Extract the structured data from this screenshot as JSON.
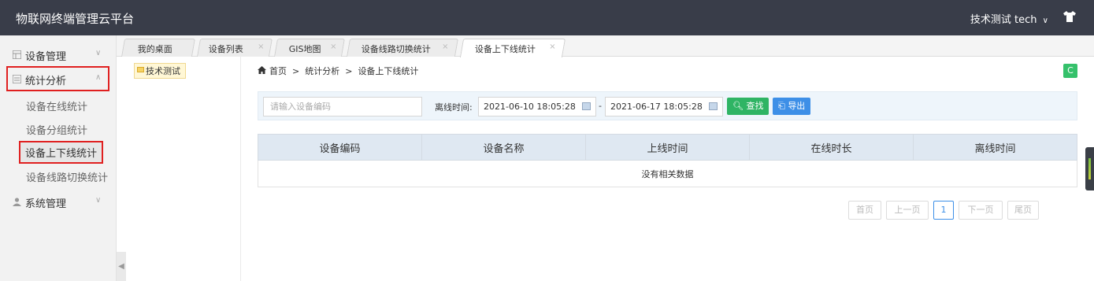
{
  "app": {
    "title": "物联网终端管理云平台",
    "user": "技术测试 tech",
    "user_caret": "∨"
  },
  "sidebar": {
    "groups": [
      {
        "label": "设备管理",
        "icon": "grid-icon",
        "arrow": "∨"
      },
      {
        "label": "统计分析",
        "icon": "chart-icon",
        "arrow": "∧"
      },
      {
        "label": "系统管理",
        "icon": "user-icon",
        "arrow": "∨"
      }
    ],
    "sub_items": [
      "设备在线统计",
      "设备分组统计",
      "设备上下线统计",
      "设备线路切换统计"
    ],
    "collapse_glyph": "◀"
  },
  "tabs": [
    {
      "label": "我的桌面",
      "closable": false
    },
    {
      "label": "设备列表",
      "closable": true
    },
    {
      "label": "GIS地图",
      "closable": true
    },
    {
      "label": "设备线路切换统计",
      "closable": true
    },
    {
      "label": "设备上下线统计",
      "closable": true
    }
  ],
  "tab_close_glyph": "×",
  "tree": {
    "node": "技术测试"
  },
  "breadcrumb": {
    "home": "首页",
    "sep": ">",
    "level1": "统计分析",
    "level2": "设备上下线统计"
  },
  "toolbar": {
    "refresh_glyph": "C"
  },
  "search": {
    "placeholder": "请输入设备编码",
    "offline_label": "离线时间:",
    "date_from": "2021-06-10 18:05:28",
    "date_dash": "-",
    "date_to": "2021-06-17 18:05:28",
    "search_button": "查找",
    "export_button": "导出"
  },
  "table": {
    "columns": [
      "设备编码",
      "设备名称",
      "上线时间",
      "在线时长",
      "离线时间"
    ],
    "empty_text": "没有相关数据"
  },
  "pager": {
    "first": "首页",
    "prev": "上一页",
    "current": "1",
    "next": "下一页",
    "last": "尾页"
  },
  "colors": {
    "topbar": "#393d49",
    "accent_green": "#2fb464",
    "accent_blue": "#3d8fe7",
    "highlight_red": "#e02020"
  }
}
